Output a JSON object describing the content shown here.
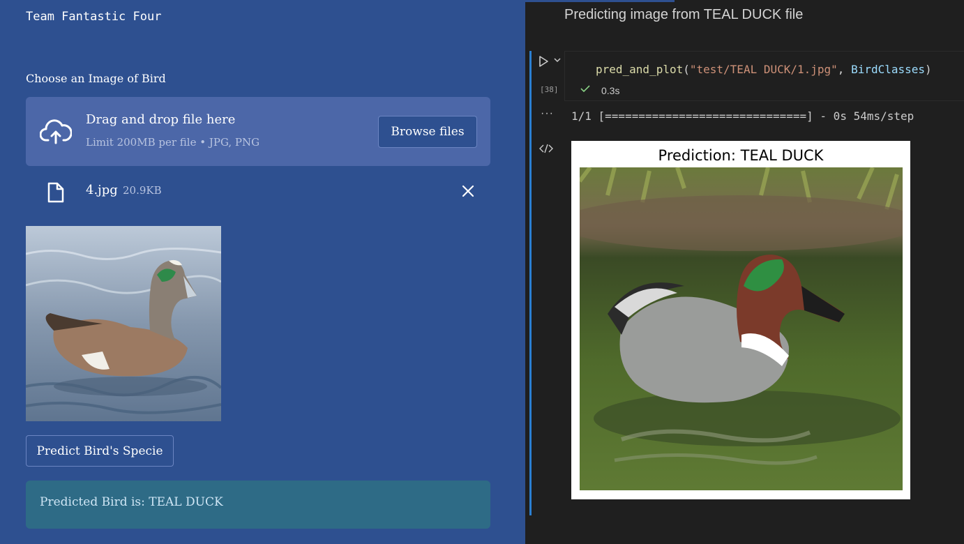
{
  "app": {
    "team_name": "Team Fantastic Four",
    "uploader_label": "Choose an Image of Bird",
    "dropzone_title": "Drag and drop file here",
    "dropzone_limit": "Limit 200MB per file • JPG, PNG",
    "browse_label": "Browse files",
    "file_name": "4.jpg",
    "file_size": "20.9KB",
    "predict_label": "Predict Bird's Specie",
    "result_text": "Predicted Bird is: TEAL DUCK"
  },
  "notebook": {
    "markdown_title": "Predicting image from TEAL DUCK file",
    "exec_count": "[38]",
    "code": {
      "func": "pred_and_plot",
      "open": "(",
      "arg_path": "\"test/TEAL DUCK/1.jpg\"",
      "sep": ", ",
      "arg_classes": "BirdClasses",
      "close": ")"
    },
    "exec_time": "0.3s",
    "output_progress": "1/1 [==============================] - 0s 54ms/step",
    "plot_title": "Prediction: TEAL DUCK"
  },
  "colors": {
    "left_bg": "#2e5090",
    "dropzone_bg": "#4c67a8",
    "result_bg": "#2e6b86",
    "editor_bg": "#1f1f1f",
    "cell_bar": "#2b7fd1"
  }
}
